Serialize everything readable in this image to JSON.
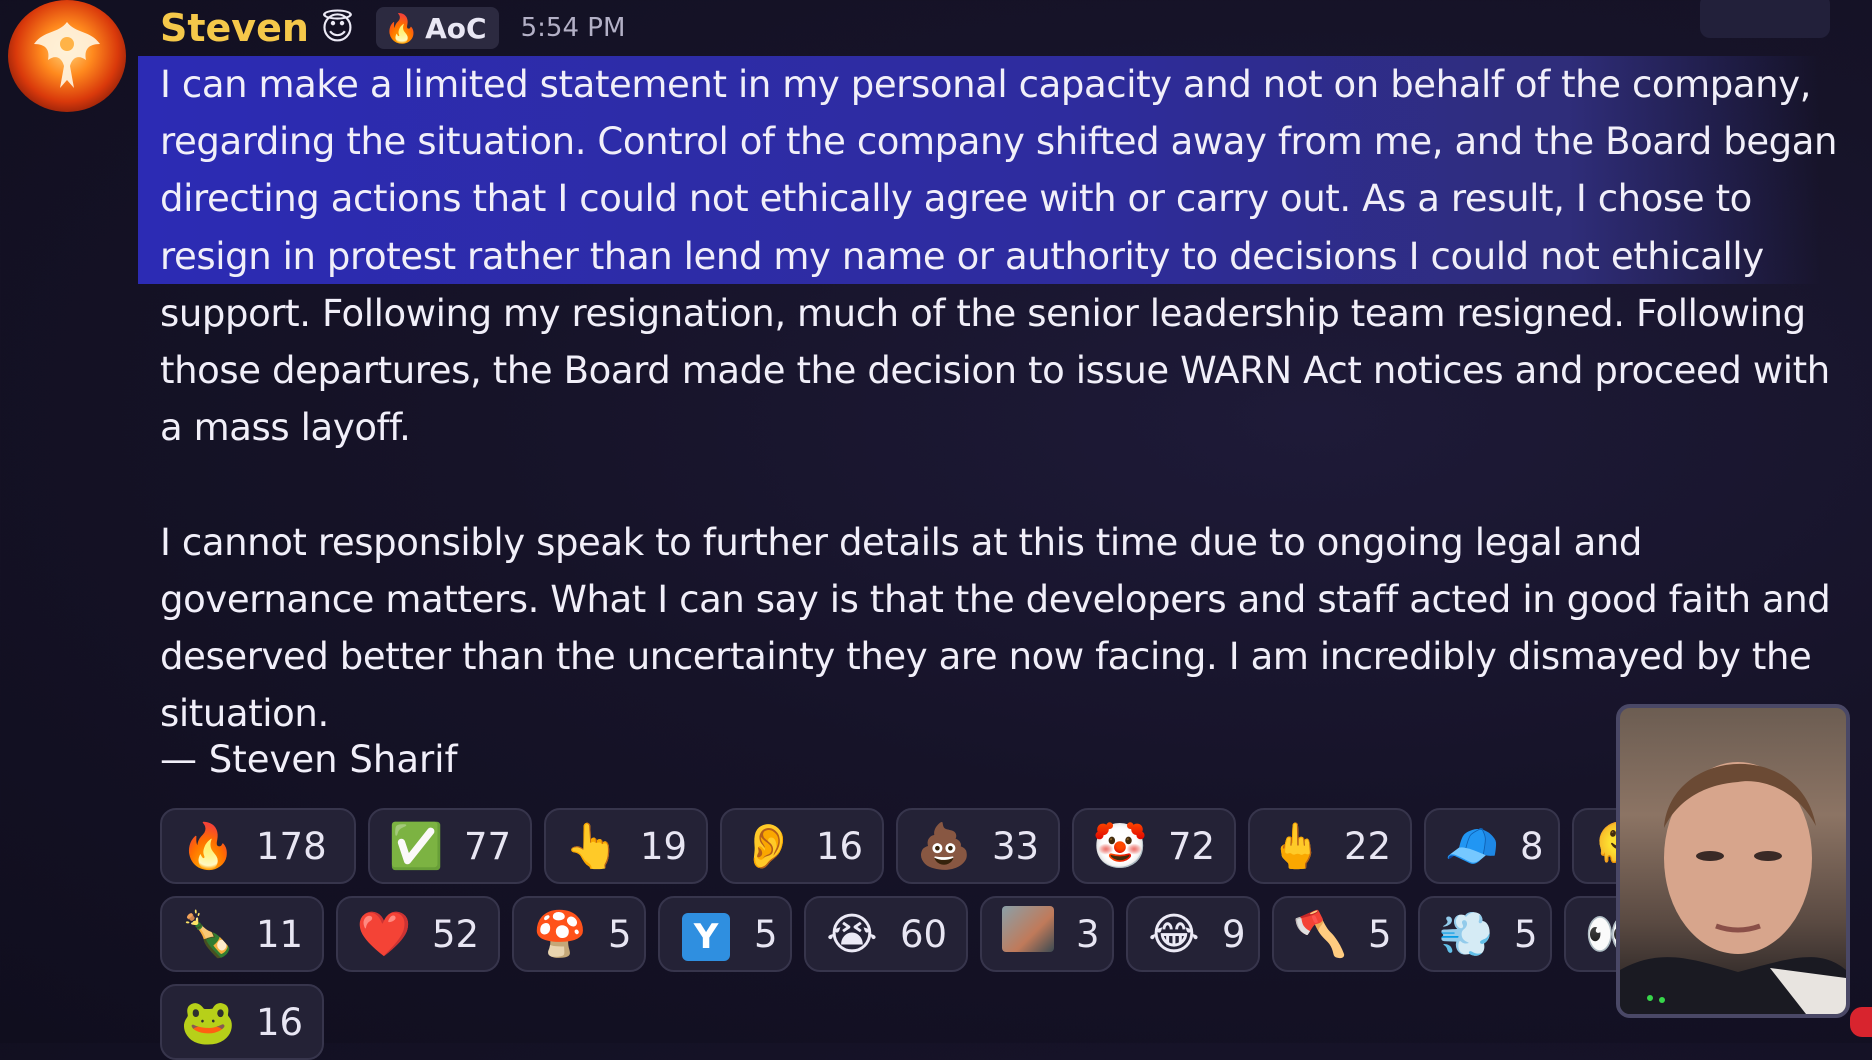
{
  "author": {
    "name": "Steven",
    "name_icon": "smiling-face-with-halo-icon",
    "tag_icon": "fire-icon",
    "tag": "AoC",
    "time": "5:54 PM",
    "avatar": "phoenix-avatar"
  },
  "message": {
    "paragraph1": "I can make a limited statement in my personal capacity and not on behalf of the company, regarding the situation. Control of the company shifted away from me, and the Board began directing actions that I could not ethically agree with or carry out. As a result, I chose to resign in protest rather than lend my name or authority to decisions I could not ethically support. Following my resignation, much of the senior leadership team resigned. Following those departures, the Board made the decision to issue WARN Act notices and proceed with a mass layoff.",
    "paragraph2": "I cannot responsibly speak to further details at this time due to ongoing legal and governance matters. What I can say is that the developers and staff acted in good faith and deserved better than the uncertainty they are now facing. I am incredibly dismayed by the situation.",
    "signature": "— Steven Sharif",
    "highlight_color": "#2c2bb4"
  },
  "reactions": [
    {
      "icon": "fire-icon",
      "emoji": "🔥",
      "count": "178"
    },
    {
      "icon": "check-mark-icon",
      "emoji": "✅",
      "count": "77"
    },
    {
      "icon": "pointing-up-icon",
      "emoji": "👆",
      "count": "19"
    },
    {
      "icon": "ear-icon",
      "emoji": "👂",
      "count": "16"
    },
    {
      "icon": "poop-icon",
      "emoji": "💩",
      "count": "33"
    },
    {
      "icon": "clown-icon",
      "emoji": "🤡",
      "count": "72"
    },
    {
      "icon": "middle-finger-icon",
      "emoji": "🖕",
      "count": "22"
    },
    {
      "icon": "blue-cap-icon",
      "emoji": "🧢",
      "count": "8"
    },
    {
      "icon": "partial-emoji-icon",
      "emoji": "🫠",
      "count": ""
    },
    {
      "icon": "bottle-icon",
      "emoji": "🍾",
      "count": "11"
    },
    {
      "icon": "red-heart-icon",
      "emoji": "❤️",
      "count": "52"
    },
    {
      "icon": "red-cap-character-icon",
      "emoji": "🍄",
      "count": "5"
    },
    {
      "icon": "y-combinator-icon",
      "emoji": "Y",
      "count": "5"
    },
    {
      "icon": "crying-face-icon",
      "emoji": "😭",
      "count": "60"
    },
    {
      "icon": "meme-image-icon",
      "emoji": "🖼️",
      "count": "3"
    },
    {
      "icon": "tears-of-joy-icon",
      "emoji": "😂",
      "count": "9"
    },
    {
      "icon": "axe-icon",
      "emoji": "🪓",
      "count": "5"
    },
    {
      "icon": "dashing-hand-icon",
      "emoji": "💨",
      "count": "5"
    },
    {
      "icon": "eyes-icon",
      "emoji": "👀",
      "count": ""
    },
    {
      "icon": "scam-frog-icon",
      "emoji": "🐸",
      "count": "16"
    }
  ]
}
